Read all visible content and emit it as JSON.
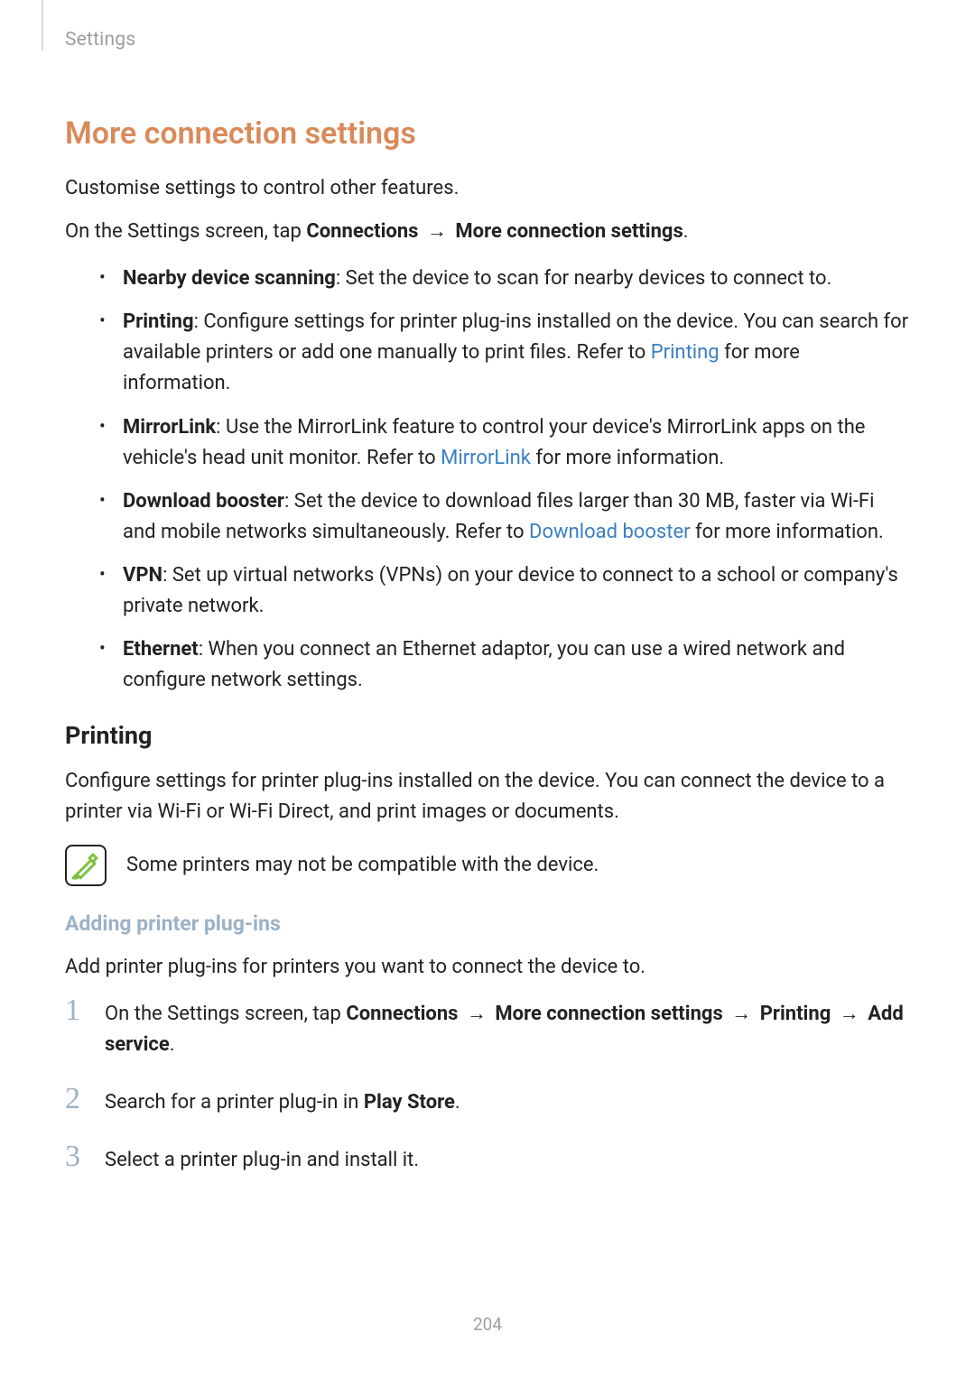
{
  "breadcrumb": "Settings",
  "section_title": "More connection settings",
  "intro": "Customise settings to control other features.",
  "path_prefix": "On the Settings screen, tap ",
  "path_parts": {
    "a": "Connections",
    "b": "More connection settings"
  },
  "arrow": "→",
  "period": ".",
  "bullets": {
    "nearby": {
      "label": "Nearby device scanning",
      "text": ": Set the device to scan for nearby devices to connect to."
    },
    "printing": {
      "label": "Printing",
      "pre": ": Configure settings for printer plug-ins installed on the device. You can search for available printers or add one manually to print files. Refer to ",
      "link": "Printing",
      "post": " for more information."
    },
    "mirror": {
      "label": "MirrorLink",
      "pre": ": Use the MirrorLink feature to control your device's MirrorLink apps on the vehicle's head unit monitor. Refer to ",
      "link": "MirrorLink",
      "post": " for more information."
    },
    "booster": {
      "label": "Download booster",
      "pre": ": Set the device to download files larger than 30 MB, faster via Wi-Fi and mobile networks simultaneously. Refer to ",
      "link": "Download booster",
      "post": " for more information."
    },
    "vpn": {
      "label": "VPN",
      "text": ": Set up virtual networks (VPNs) on your device to connect to a school or company's private network."
    },
    "ethernet": {
      "label": "Ethernet",
      "text": ": When you connect an Ethernet adaptor, you can use a wired network and configure network settings."
    }
  },
  "printing_heading": "Printing",
  "printing_intro": "Configure settings for printer plug-ins installed on the device. You can connect the device to a printer via Wi-Fi or Wi-Fi Direct, and print images or documents.",
  "note_text": "Some printers may not be compatible with the device.",
  "adding_heading": "Adding printer plug-ins",
  "adding_intro": "Add printer plug-ins for printers you want to connect the device to.",
  "steps": {
    "s1": {
      "num": "1",
      "pre": "On the Settings screen, tap ",
      "a": "Connections",
      "b": "More connection settings",
      "c": "Printing",
      "d": "Add service"
    },
    "s2": {
      "num": "2",
      "pre": "Search for a printer plug-in in ",
      "bold": "Play Store"
    },
    "s3": {
      "num": "3",
      "text": "Select a printer plug-in and install it."
    }
  },
  "page_number": "204"
}
